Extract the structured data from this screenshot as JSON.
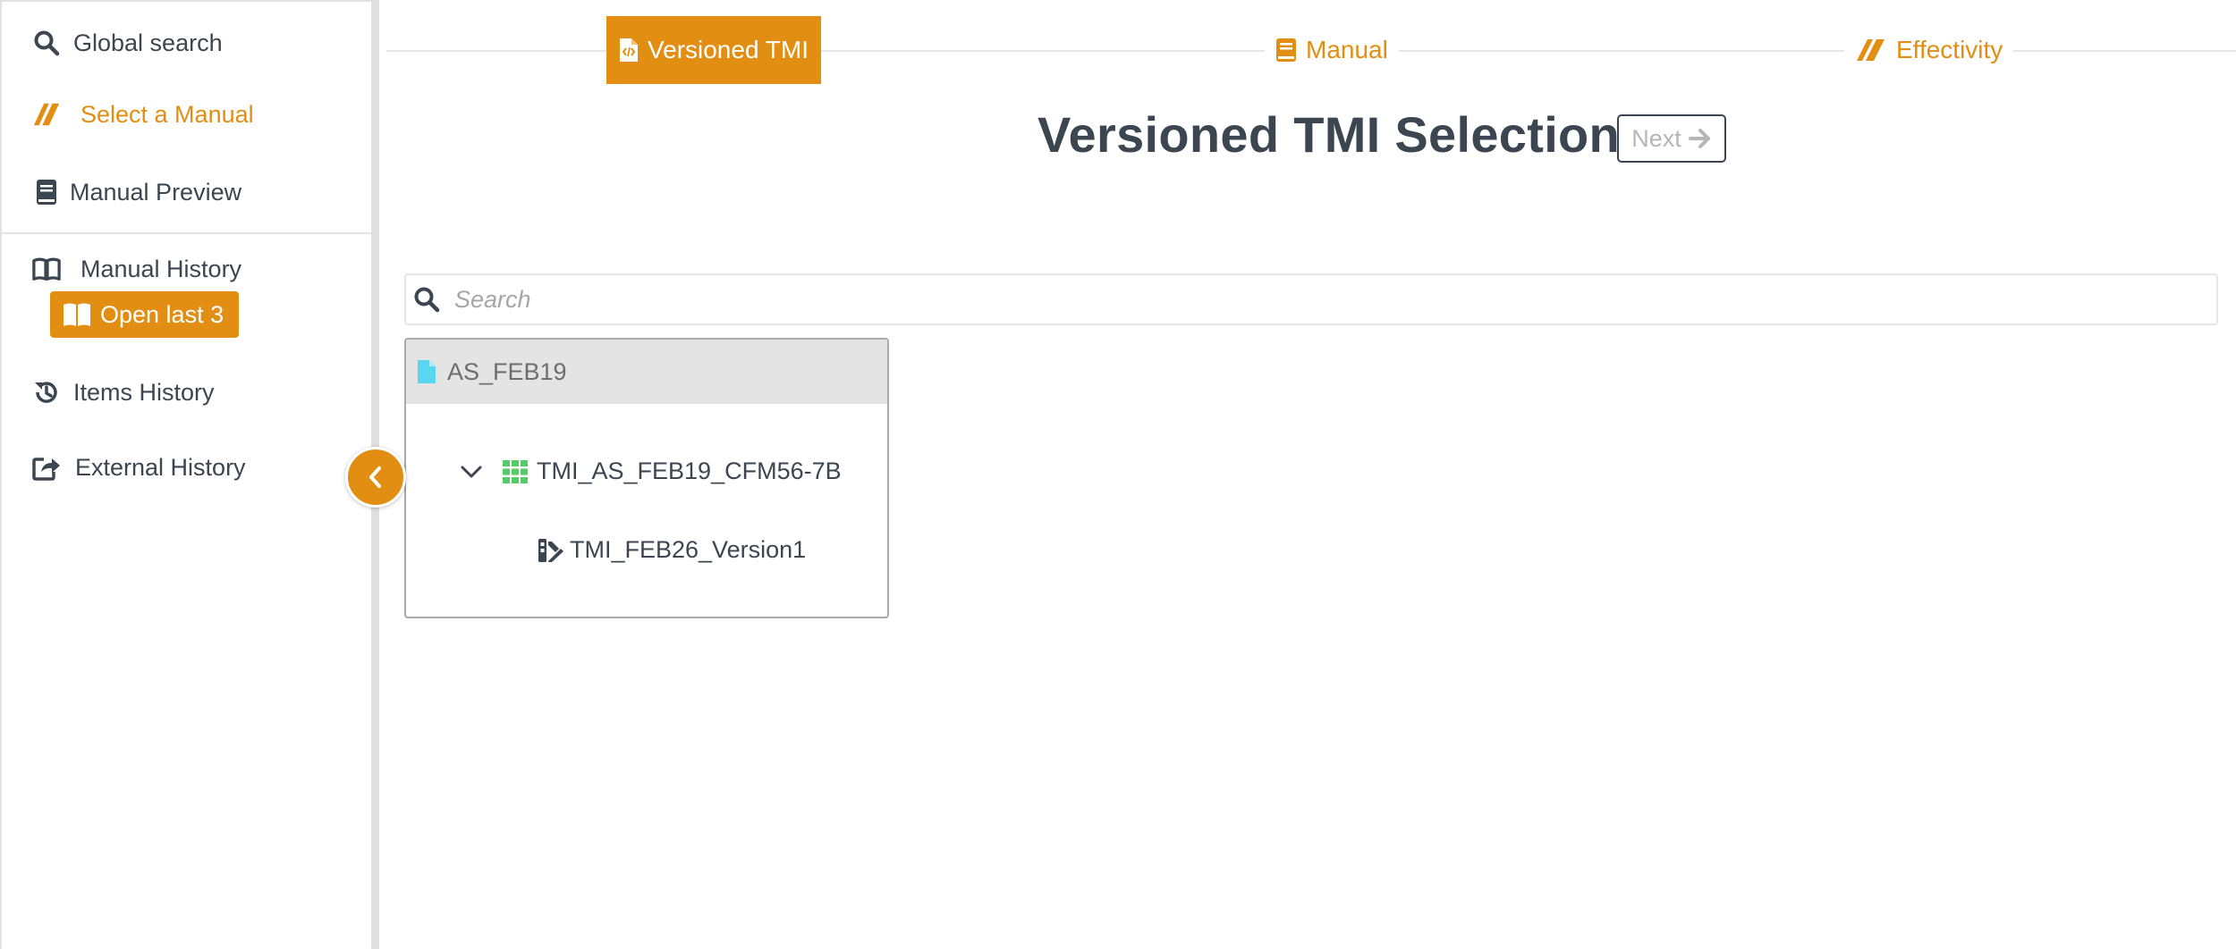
{
  "sidebar": {
    "items": [
      {
        "label": "Global search",
        "icon": "search-icon"
      },
      {
        "label": "Select a Manual",
        "icon": "manual-select-icon",
        "active": true
      },
      {
        "label": "Manual Preview",
        "icon": "book-icon"
      },
      {
        "label": "Manual History",
        "icon": "open-book-icon"
      },
      {
        "label": "Items History",
        "icon": "history-icon"
      },
      {
        "label": "External History",
        "icon": "share-icon"
      }
    ],
    "open_last_label": "Open last 3",
    "collapse_icon": "chevron-left-icon"
  },
  "stepper": {
    "steps": [
      {
        "label": "Versioned TMI",
        "icon": "file-code-icon",
        "active": true
      },
      {
        "label": "Manual",
        "icon": "book-icon",
        "active": false
      },
      {
        "label": "Effectivity",
        "icon": "manual-select-icon",
        "active": false
      }
    ]
  },
  "main": {
    "title": "Versioned TMI Selection",
    "next_label": "Next",
    "search_placeholder": "Search",
    "search_value": ""
  },
  "tree": {
    "root": {
      "label": "AS_FEB19",
      "icon": "file-icon"
    },
    "child": {
      "label": "TMI_AS_FEB19_CFM56-7B",
      "icon": "grid-icon",
      "expanded": true
    },
    "grandchild": {
      "label": "TMI_FEB26_Version1",
      "icon": "version-icon"
    }
  },
  "colors": {
    "accent": "#e28e12",
    "text": "#3b4650",
    "file_icon": "#5ad7f0",
    "grid_icon": "#55cc66"
  }
}
